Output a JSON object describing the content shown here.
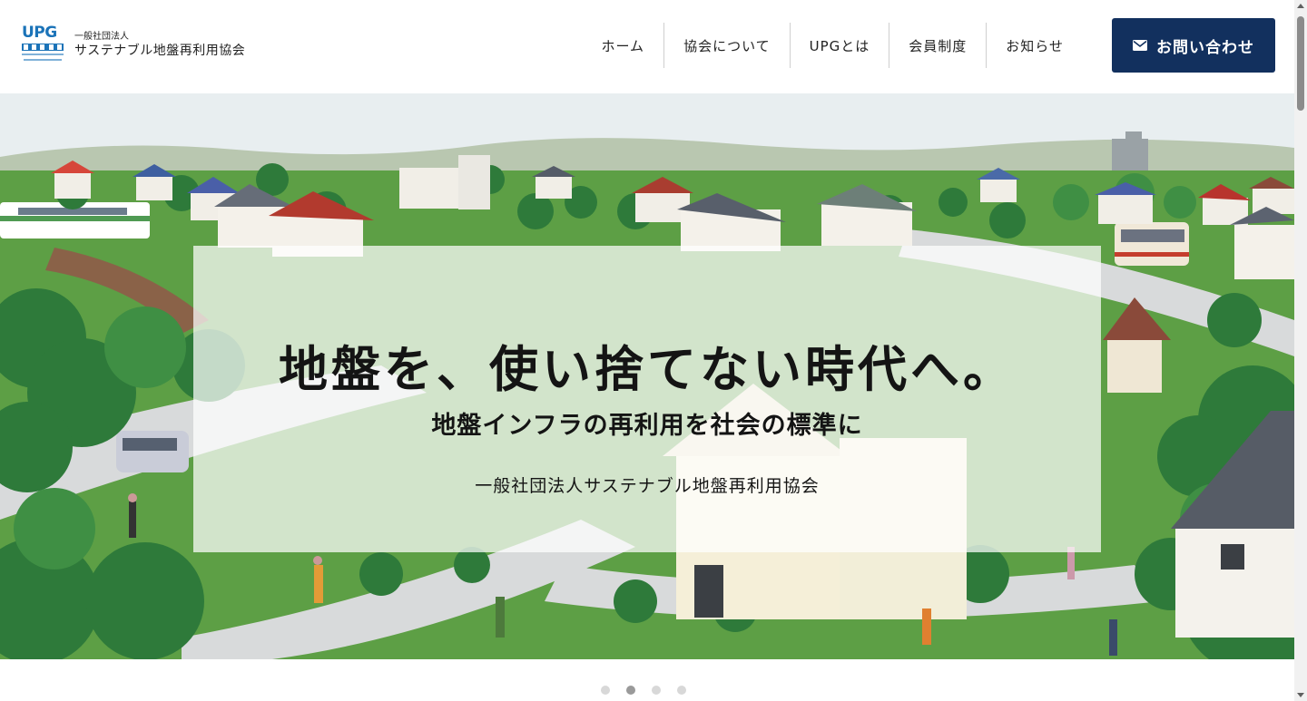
{
  "logo": {
    "mark_text": "UPG",
    "small_text": "一般社団法人",
    "name": "サステナブル地盤再利用協会"
  },
  "nav": {
    "items": [
      {
        "label": "ホーム"
      },
      {
        "label": "協会について"
      },
      {
        "label": "UPGとは"
      },
      {
        "label": "会員制度"
      },
      {
        "label": "お知らせ"
      }
    ],
    "contact_label": "お問い合わせ"
  },
  "hero": {
    "headline": "地盤を、使い捨てない時代へ。",
    "subline": "地盤インフラの再利用を社会の標準に",
    "organization": "一般社団法人サステナブル地盤再利用協会"
  },
  "slider": {
    "total_slides": 4,
    "active_slide": 2
  },
  "colors": {
    "brand_navy": "#12305e",
    "logo_blue": "#1b73b8"
  }
}
